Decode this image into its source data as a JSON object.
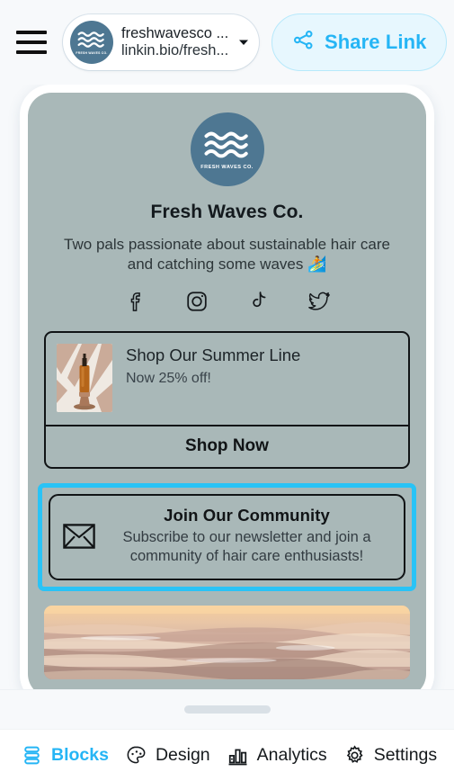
{
  "colors": {
    "accent": "#25B5F5",
    "selection": "#29C3F6",
    "share_bg": "#E7F7FE",
    "phone_bg": "#A9B8B8",
    "page_bg": "#F7F9FB",
    "logo_blue": "#4E7792",
    "block_border": "#111416"
  },
  "header": {
    "menu_icon": "hamburger-icon",
    "site_picker": {
      "avatar_icon": "fresh-waves-logo-icon",
      "avatar_caption": "FRESH WAVES CO.",
      "account_name": "freshwavesco ...",
      "account_url": "linkin.bio/fresh...",
      "caret_icon": "chevron-down-icon"
    },
    "share_button": {
      "icon": "share-nodes-icon",
      "label": "Share Link"
    }
  },
  "preview": {
    "profile": {
      "avatar_icon": "fresh-waves-logo-icon",
      "avatar_caption": "FRESH WAVES CO.",
      "name": "Fresh Waves Co.",
      "bio": "Two pals passionate about sustainable hair care and catching some waves 🏄"
    },
    "socials": [
      {
        "name": "facebook",
        "icon": "facebook-icon"
      },
      {
        "name": "instagram",
        "icon": "instagram-icon"
      },
      {
        "name": "tiktok",
        "icon": "tiktok-icon"
      },
      {
        "name": "twitter",
        "icon": "twitter-icon"
      }
    ],
    "blocks": {
      "product": {
        "thumbnail_icon": "product-photo-dropper-bottle",
        "title": "Shop Our Summer Line",
        "subtitle": "Now 25% off!",
        "cta_label": "Shop Now"
      },
      "newsletter": {
        "selected": true,
        "icon": "envelope-icon",
        "title": "Join Our Community",
        "description": "Subscribe to our newsletter and join a community of hair care enthusiasts!"
      },
      "image": {
        "icon": "beach-sunset-photo"
      }
    }
  },
  "sheet": {
    "handle_icon": "drag-handle"
  },
  "bottom_nav": {
    "items": [
      {
        "label": "Blocks",
        "icon": "blocks-icon",
        "active": true
      },
      {
        "label": "Design",
        "icon": "palette-icon",
        "active": false
      },
      {
        "label": "Analytics",
        "icon": "bar-chart-icon",
        "active": false
      },
      {
        "label": "Settings",
        "icon": "gear-icon",
        "active": false
      }
    ]
  }
}
